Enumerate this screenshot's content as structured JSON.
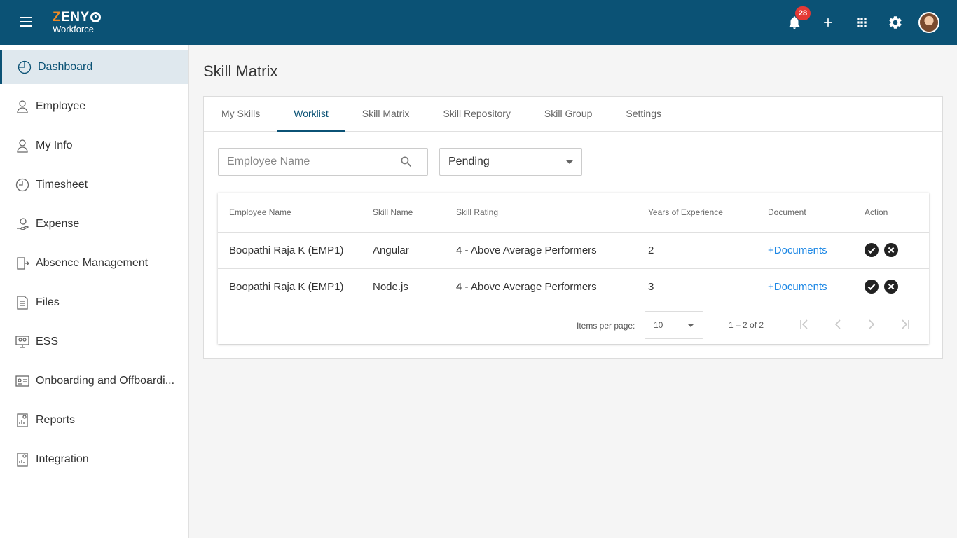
{
  "header": {
    "logo_brand_prefix": "ZENY",
    "logo_sub": "Workforce",
    "notification_count": "28"
  },
  "sidebar": {
    "items": [
      {
        "label": "Dashboard",
        "icon": "pie-chart-icon"
      },
      {
        "label": "Employee",
        "icon": "person-icon"
      },
      {
        "label": "My Info",
        "icon": "person-icon"
      },
      {
        "label": "Timesheet",
        "icon": "clock-icon"
      },
      {
        "label": "Expense",
        "icon": "money-hand-icon"
      },
      {
        "label": "Absence Management",
        "icon": "exit-door-icon"
      },
      {
        "label": "Files",
        "icon": "document-icon"
      },
      {
        "label": "ESS",
        "icon": "monitor-people-icon"
      },
      {
        "label": "Onboarding and Offboardi...",
        "icon": "id-card-icon"
      },
      {
        "label": "Reports",
        "icon": "report-icon"
      },
      {
        "label": "Integration",
        "icon": "report-icon"
      }
    ]
  },
  "page": {
    "title": "Skill Matrix"
  },
  "tabs": [
    "My Skills",
    "Worklist",
    "Skill Matrix",
    "Skill Repository",
    "Skill Group",
    "Settings"
  ],
  "filters": {
    "search_placeholder": "Employee Name",
    "status_value": "Pending"
  },
  "table": {
    "headers": [
      "Employee Name",
      "Skill Name",
      "Skill Rating",
      "Years of Experience",
      "Document",
      "Action"
    ],
    "rows": [
      {
        "employee": "Boopathi Raja K (EMP1)",
        "skill": "Angular",
        "rating": "4 - Above Average Performers",
        "years": "2",
        "document": "+Documents"
      },
      {
        "employee": "Boopathi Raja K (EMP1)",
        "skill": "Node.js",
        "rating": "4 - Above Average Performers",
        "years": "3",
        "document": "+Documents"
      }
    ]
  },
  "paginator": {
    "items_per_page_label": "Items per page:",
    "page_size": "10",
    "range": "1 – 2 of 2"
  },
  "colors": {
    "header_bg": "#0b5275",
    "accent": "#0b5275",
    "logo_orange": "#f08a24",
    "link": "#1e88e5",
    "badge": "#e53935"
  }
}
